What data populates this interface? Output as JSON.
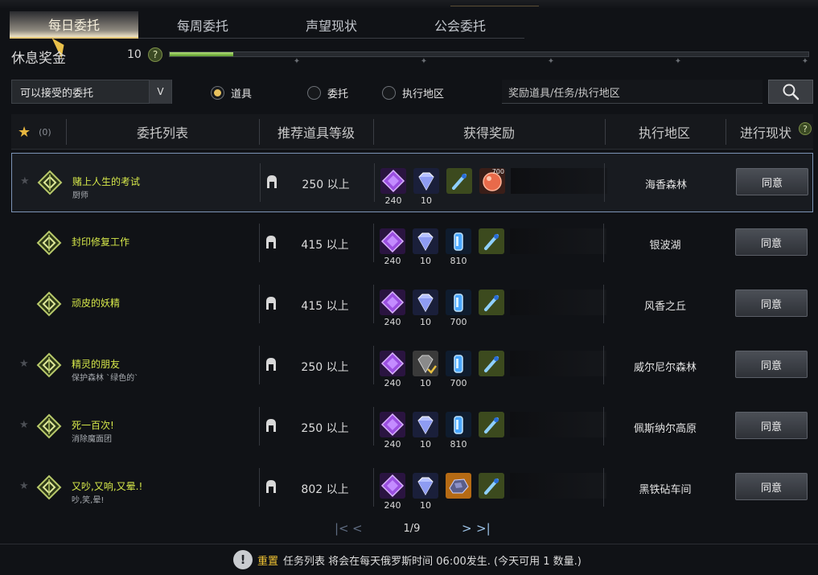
{
  "tabs": [
    {
      "label": "每日委托",
      "active": true
    },
    {
      "label": "每周委托",
      "active": false
    },
    {
      "label": "声望现状",
      "active": false
    },
    {
      "label": "公会委托",
      "active": false
    }
  ],
  "rest_bonus": {
    "label": "休息奖金",
    "value": "10",
    "help": "?",
    "progress_fraction": 0.1
  },
  "filter": {
    "selected": "可以接受的委托",
    "arrow": "V"
  },
  "radios": [
    {
      "label": "道具",
      "checked": true
    },
    {
      "label": "委托",
      "checked": false
    },
    {
      "label": "执行地区",
      "checked": false
    }
  ],
  "search": {
    "placeholder": "奖励道具/任务/执行地区"
  },
  "header": {
    "fav_star": "★",
    "fav_count": "(0)",
    "quest_list": "委托列表",
    "item_level": "推荐道具等级",
    "rewards": "获得奖励",
    "region": "执行地区",
    "status": "进行现状",
    "help": "?"
  },
  "accept_label": "同意",
  "rows": [
    {
      "title": "赌上人生的考试",
      "subtitle": "厨师",
      "level": "250 以上",
      "region": "海香森林",
      "selected": true,
      "starred": true,
      "rewards": [
        {
          "icon": "purple-crystal-icon",
          "count": "240"
        },
        {
          "icon": "silver-gem-icon",
          "count": "10"
        },
        {
          "icon": "blue-potion-icon",
          "count": ""
        },
        {
          "icon": "orange-orb-icon",
          "count": "",
          "corner": "700"
        }
      ]
    },
    {
      "title": "封印修复工作",
      "subtitle": "",
      "level": "415 以上",
      "region": "银波湖",
      "selected": false,
      "starred": false,
      "rewards": [
        {
          "icon": "purple-crystal-icon",
          "count": "240"
        },
        {
          "icon": "silver-gem-icon",
          "count": "10"
        },
        {
          "icon": "blue-shard-icon",
          "count": "810"
        },
        {
          "icon": "blue-potion-icon",
          "count": ""
        }
      ]
    },
    {
      "title": "顽皮的妖精",
      "subtitle": "",
      "level": "415 以上",
      "region": "风香之丘",
      "selected": false,
      "starred": false,
      "rewards": [
        {
          "icon": "purple-crystal-icon",
          "count": "240"
        },
        {
          "icon": "silver-gem-icon",
          "count": "10"
        },
        {
          "icon": "blue-shard-icon",
          "count": "700"
        },
        {
          "icon": "blue-potion-icon",
          "count": ""
        }
      ]
    },
    {
      "title": "精灵的朋友",
      "subtitle": "保护森林 `绿色的`",
      "level": "250 以上",
      "region": "威尔尼尔森林",
      "selected": false,
      "starred": true,
      "rewards": [
        {
          "icon": "purple-crystal-icon",
          "count": "240"
        },
        {
          "icon": "gray-gem-checked-icon",
          "count": "10"
        },
        {
          "icon": "blue-shard-icon",
          "count": "700"
        },
        {
          "icon": "blue-potion-icon",
          "count": ""
        }
      ]
    },
    {
      "title": "死一百次!",
      "subtitle": "消除魔面团",
      "level": "250 以上",
      "region": "佩斯纳尔高原",
      "selected": false,
      "starred": true,
      "rewards": [
        {
          "icon": "purple-crystal-icon",
          "count": "240"
        },
        {
          "icon": "silver-gem-icon",
          "count": "10"
        },
        {
          "icon": "blue-shard-icon",
          "count": "810"
        },
        {
          "icon": "blue-potion-icon",
          "count": ""
        }
      ]
    },
    {
      "title": "又吵,又响,又晕.!",
      "subtitle": "吵,笑,晕!",
      "level": "802 以上",
      "region": "黑铁砧车间",
      "selected": false,
      "starred": true,
      "rewards": [
        {
          "icon": "purple-crystal-icon",
          "count": "240"
        },
        {
          "icon": "silver-gem-icon",
          "count": "10"
        },
        {
          "icon": "ore-chunk-icon",
          "count": ""
        },
        {
          "icon": "blue-potion-icon",
          "count": ""
        }
      ]
    }
  ],
  "pager": {
    "text": "1/9",
    "first": "|<",
    "prev": "<",
    "next": ">",
    "last": ">|"
  },
  "notice": {
    "icon": "!",
    "key": "重置",
    "text": "任务列表 将会在每天俄罗斯时间 06:00发生. (今天可用 1 数量.)"
  }
}
